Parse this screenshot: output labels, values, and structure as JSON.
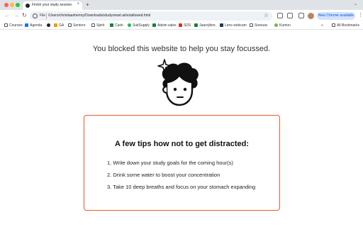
{
  "browser": {
    "tab_title": "Finish your study session",
    "tab_close": "×",
    "new_tab": "+",
    "tab_menu": "⌄",
    "back": "←",
    "forward": "→",
    "reload": "↻",
    "scheme_label": "File",
    "url": "/Users/christiaanhenny/Downloads/studysmart.ai/notallowed.html",
    "star": "☆",
    "update_button": "New Chrome available",
    "more": "⋮"
  },
  "bookmarks": {
    "items": [
      {
        "label": "Courses",
        "icon": "folder-icon",
        "color": "#555555"
      },
      {
        "label": "Agenda",
        "icon": "calendar-icon",
        "color": "#1a73e8"
      },
      {
        "label": "",
        "icon": "github-icon",
        "color": "#222222"
      },
      {
        "label": "GA",
        "icon": "analytics-icon",
        "color": "#f29900"
      },
      {
        "label": "Sentoro",
        "icon": "folder-icon",
        "color": "#555555"
      },
      {
        "label": "Spirit",
        "icon": "folder-icon",
        "color": "#555555"
      },
      {
        "label": "Cash",
        "icon": "sheet-icon",
        "color": "#188038"
      },
      {
        "label": "SuitSupply",
        "icon": "spotify-icon",
        "color": "#1db954"
      },
      {
        "label": "Adwin sales",
        "icon": "sheet-icon",
        "color": "#188038"
      },
      {
        "label": "SDS",
        "icon": "doc-icon",
        "color": "#d93025"
      },
      {
        "label": "Jaarcijfers",
        "icon": "sheet-icon",
        "color": "#188038"
      },
      {
        "label": "Lens webcam",
        "icon": "lens-icon",
        "color": "#1f3a60"
      },
      {
        "label": "Sneeuw",
        "icon": "folder-icon",
        "color": "#555555"
      },
      {
        "label": "Kumon",
        "icon": "kumon-icon",
        "color": "#7cb342"
      }
    ],
    "overflow": "»",
    "all_bookmarks": "All Bookmarks"
  },
  "page": {
    "headline": "You blocked this website to help you stay focussed.",
    "tips_title": "A few tips how not to get distracted:",
    "tips": [
      "1. Write down your study goals for the coming hour(s)",
      "2. Drink some water to boost your concentration",
      "3. Take 10 deep breaths and focus on your stomach expanding"
    ]
  },
  "colors": {
    "accent": "#e65c24",
    "update_bg": "#d3e3fd",
    "update_text": "#0b57d0"
  }
}
